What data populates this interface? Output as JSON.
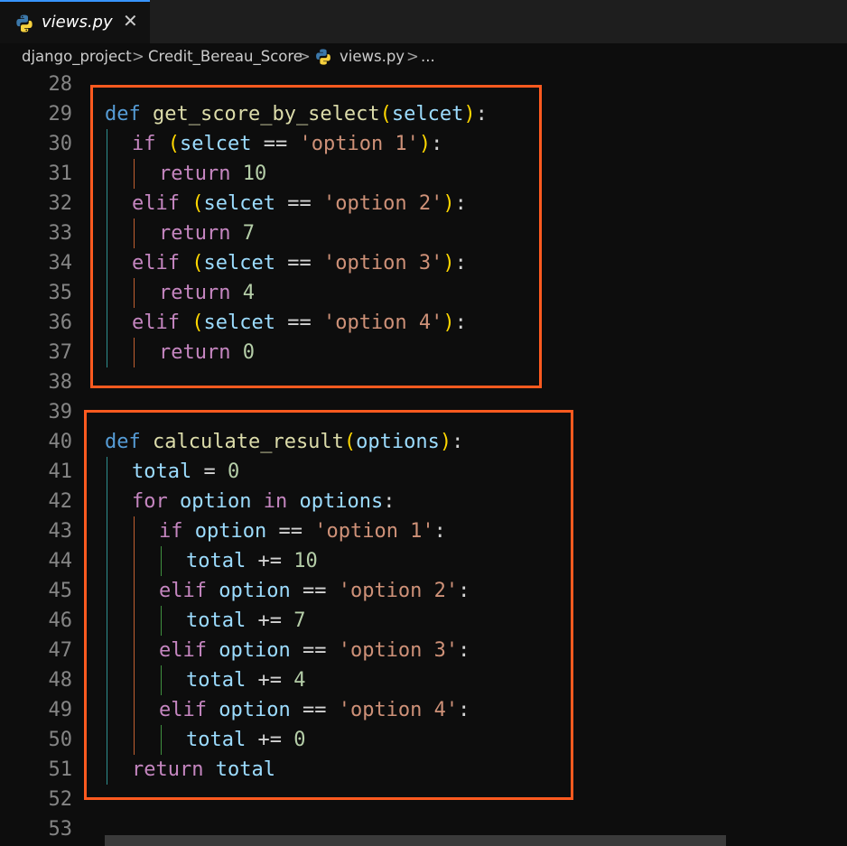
{
  "tab": {
    "filename": "views.py",
    "close": "✕"
  },
  "breadcrumb": {
    "folder": "django_project",
    "subfolder": "Credit_Bereau_Score",
    "file": "views.py",
    "more": "...",
    "sep": ">"
  },
  "line_numbers": [
    "28",
    "29",
    "30",
    "31",
    "32",
    "33",
    "34",
    "35",
    "36",
    "37",
    "38",
    "39",
    "40",
    "41",
    "42",
    "43",
    "44",
    "45",
    "46",
    "47",
    "48",
    "49",
    "50",
    "51",
    "52",
    "53"
  ],
  "code": {
    "l29": {
      "kw": "def",
      "fn": "get_score_by_select",
      "p1": "(",
      "arg": "selcet",
      "p2": ")",
      "colon": ":"
    },
    "l30": {
      "kw": "if",
      "p1": "(",
      "var": "selcet",
      "op": " == ",
      "str": "'option 1'",
      "p2": ")",
      "colon": ":"
    },
    "l31": {
      "kw": "return",
      "num": "10"
    },
    "l32": {
      "kw": "elif",
      "p1": "(",
      "var": "selcet",
      "op": " == ",
      "str": "'option 2'",
      "p2": ")",
      "colon": ":"
    },
    "l33": {
      "kw": "return",
      "num": "7"
    },
    "l34": {
      "kw": "elif",
      "p1": "(",
      "var": "selcet",
      "op": " == ",
      "str": "'option 3'",
      "p2": ")",
      "colon": ":"
    },
    "l35": {
      "kw": "return",
      "num": "4"
    },
    "l36": {
      "kw": "elif",
      "p1": "(",
      "var": "selcet",
      "op": " == ",
      "str": "'option 4'",
      "p2": ")",
      "colon": ":"
    },
    "l37": {
      "kw": "return",
      "num": "0"
    },
    "l40": {
      "kw": "def",
      "fn": "calculate_result",
      "p1": "(",
      "arg": "options",
      "p2": ")",
      "colon": ":"
    },
    "l41": {
      "var": "total",
      "op": " = ",
      "num": "0"
    },
    "l42": {
      "kw": "for",
      "var": "option",
      "kw2": "in",
      "var2": "options",
      "colon": ":"
    },
    "l43": {
      "kw": "if",
      "var": "option",
      "op": " == ",
      "str": "'option 1'",
      "colon": ":"
    },
    "l44": {
      "var": "total",
      "op": " += ",
      "num": "10"
    },
    "l45": {
      "kw": "elif",
      "var": "option",
      "op": " == ",
      "str": "'option 2'",
      "colon": ":"
    },
    "l46": {
      "var": "total",
      "op": " += ",
      "num": "7"
    },
    "l47": {
      "kw": "elif",
      "var": "option",
      "op": " == ",
      "str": "'option 3'",
      "colon": ":"
    },
    "l48": {
      "var": "total",
      "op": " += ",
      "num": "4"
    },
    "l49": {
      "kw": "elif",
      "var": "option",
      "op": " == ",
      "str": "'option 4'",
      "colon": ":"
    },
    "l50": {
      "var": "total",
      "op": " += ",
      "num": "0"
    },
    "l51": {
      "kw": "return",
      "var": "total"
    }
  },
  "colors": {
    "highlight": "#ff5a1f",
    "keyword_def": "#569cd6",
    "keyword_control": "#c586c0",
    "function": "#dcdcaa",
    "variable": "#9cdcfe",
    "string": "#ce9178",
    "number": "#b5cea8"
  }
}
